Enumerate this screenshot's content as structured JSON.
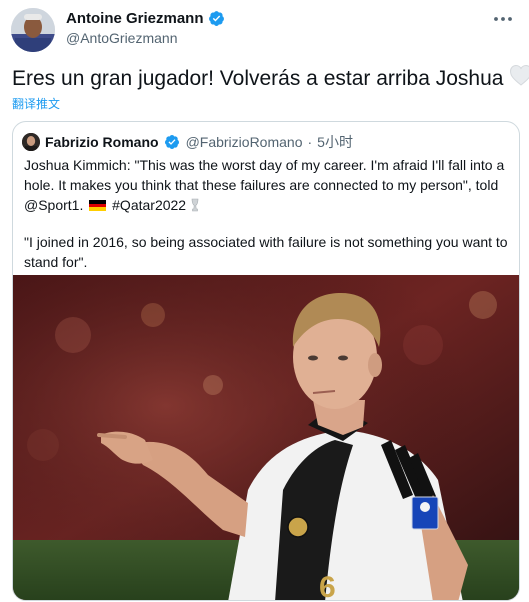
{
  "tweet": {
    "author_name": "Antoine Griezmann",
    "author_handle": "@AntoGriezmann",
    "text": "Eres un gran jugador! Volverás a estar arriba Joshua",
    "translate_label": "翻译推文"
  },
  "quoted": {
    "author_name": "Fabrizio Romano",
    "author_handle": "@FabrizioRomano",
    "separator": "·",
    "time": "5小时",
    "paragraph1_main": "Joshua Kimmich: \"This was the worst day of my career. I'm afraid I'll fall into a hole. It makes you think that these failures are connected to my person\", told @Sport1.",
    "paragraph1_tag": "#Qatar2022",
    "paragraph2": "\"I joined in 2016, so being associated with failure is not something you want to stand for\".",
    "image_shirt_number": "6"
  },
  "icons": {
    "more": "more-horizontal-icon",
    "verified": "verified-badge-icon",
    "heart": "white-heart-emoji",
    "flag": "germany-flag-emoji",
    "trophy": "trophy-emoji"
  },
  "colors": {
    "accent": "#1d9bf0",
    "secondary_text": "#536471",
    "border": "#cfd9de"
  }
}
